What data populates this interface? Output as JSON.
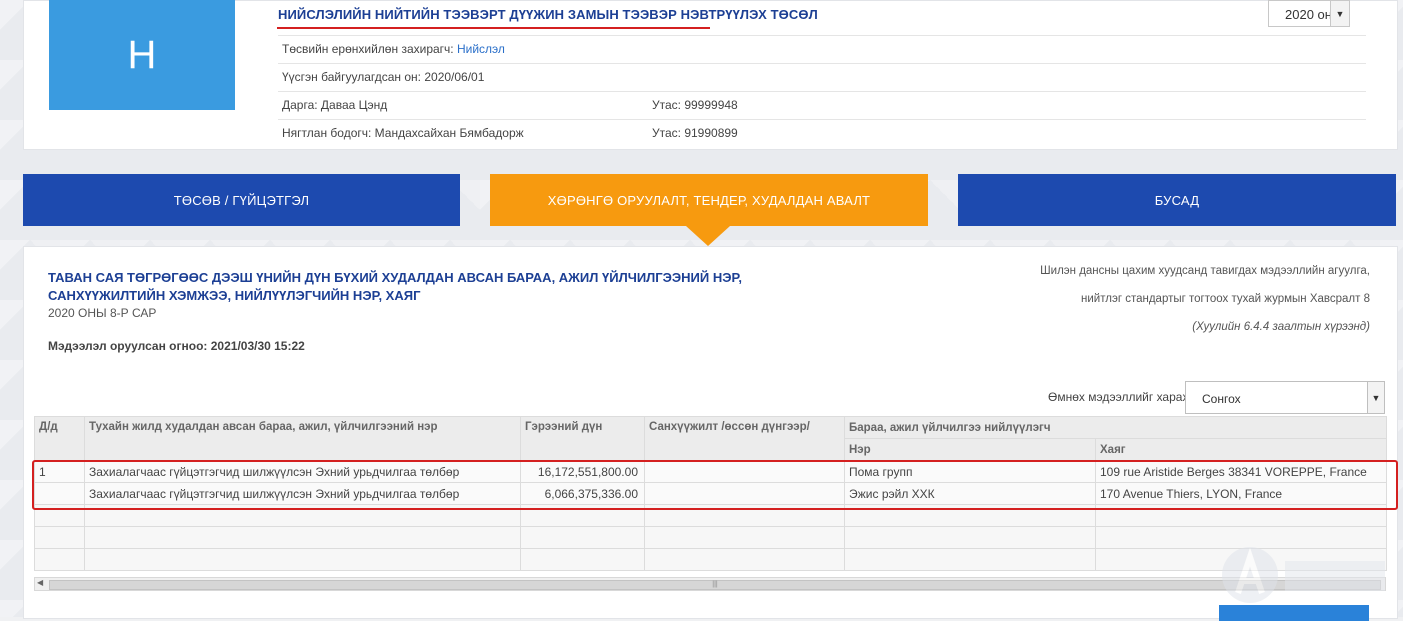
{
  "org": {
    "logo_letter": "Н",
    "title": "НИЙСЛЭЛИЙН НИЙТИЙН ТЭЭВЭРТ ДҮҮЖИН ЗАМЫН ТЭЭВЭР НЭВТРҮҮЛЭХ ТӨСӨЛ",
    "year": "2020 он",
    "manager_label": "Төсвийн ерөнхийлөн захирагч:",
    "manager_link": "Нийслэл",
    "founded": "Үүсгэн байгуулагдсан он: 2020/06/01",
    "director": "Дарга: Даваа Цэнд",
    "director_phone": "Утас: 99999948",
    "accountant": "Нягтлан бодогч: Мандахсайхан Бямбадорж",
    "accountant_phone": "Утас: 91990899"
  },
  "tabs": [
    {
      "label": "ТӨСӨВ / ГҮЙЦЭТГЭЛ",
      "active": false
    },
    {
      "label": "ХӨРӨНГӨ ОРУУЛАЛТ, ТЕНДЕР, ХУДАЛДАН АВАЛТ",
      "active": true
    },
    {
      "label": "БУСАД",
      "active": false
    }
  ],
  "report": {
    "title_line1": "ТАВАН САЯ ТӨГРӨГӨӨС ДЭЭШ ҮНИЙН ДҮН БҮХИЙ ХУДАЛДАН АВСАН БАРАА, АЖИЛ ҮЙЛЧИЛГЭЭНИЙ НЭР,",
    "title_line2": "САНХҮҮЖИЛТИЙН ХЭМЖЭЭ, НИЙЛҮҮЛЭГЧИЙН НЭР, ХАЯГ",
    "period": "2020 ОНЫ 8-Р САР",
    "updated": "Мэдээлэл оруулсан огноо: 2021/03/30 15:22",
    "legal_line1": "Шилэн дансны цахим хуудсанд тавигдах мэдээллийн агуулга,",
    "legal_line2": "нийтлэг стандартыг тогтоох тухай журмын Хавсралт 8",
    "legal_line3": "(Хуулийн 6.4.4 заалтын хүрээнд)",
    "prev_label": "Өмнөх мэдээллийг харах",
    "prev_select": "Сонгох"
  },
  "table": {
    "headers": {
      "no": "Д/д",
      "item": "Тухайн жилд худалдан авсан бараа, ажил, үйлчилгээний нэр",
      "amount": "Гэрээний дүн",
      "funding": "Санхүүжилт /өссөн дүнгээр/",
      "supplier": "Бараа, ажил үйлчилгээ нийлүүлэгч",
      "supplier_name": "Нэр",
      "supplier_address": "Хаяг"
    },
    "rows": [
      {
        "no": "1",
        "item": "Захиалагчаас гүйцэтгэгчид шилжүүлсэн Эхний урьдчилгаа төлбөр",
        "amount": "16,172,551,800.00",
        "funding": "",
        "name": "Пома групп",
        "address": "109 rue Aristide Berges 38341 VOREPPE, France"
      },
      {
        "no": "",
        "item": "Захиалагчаас гүйцэтгэгчид шилжүүлсэн Эхний урьдчилгаа төлбөр",
        "amount": "6,066,375,336.00",
        "funding": "",
        "name": "Эжис рэйл ХХК",
        "address": "170 Avenue Thiers, LYON, France"
      }
    ]
  },
  "colors": {
    "tab_blue": "#1d4aaf",
    "tab_active": "#f79a0f",
    "title_blue": "#1c3f94",
    "highlight_red": "#d42020"
  }
}
